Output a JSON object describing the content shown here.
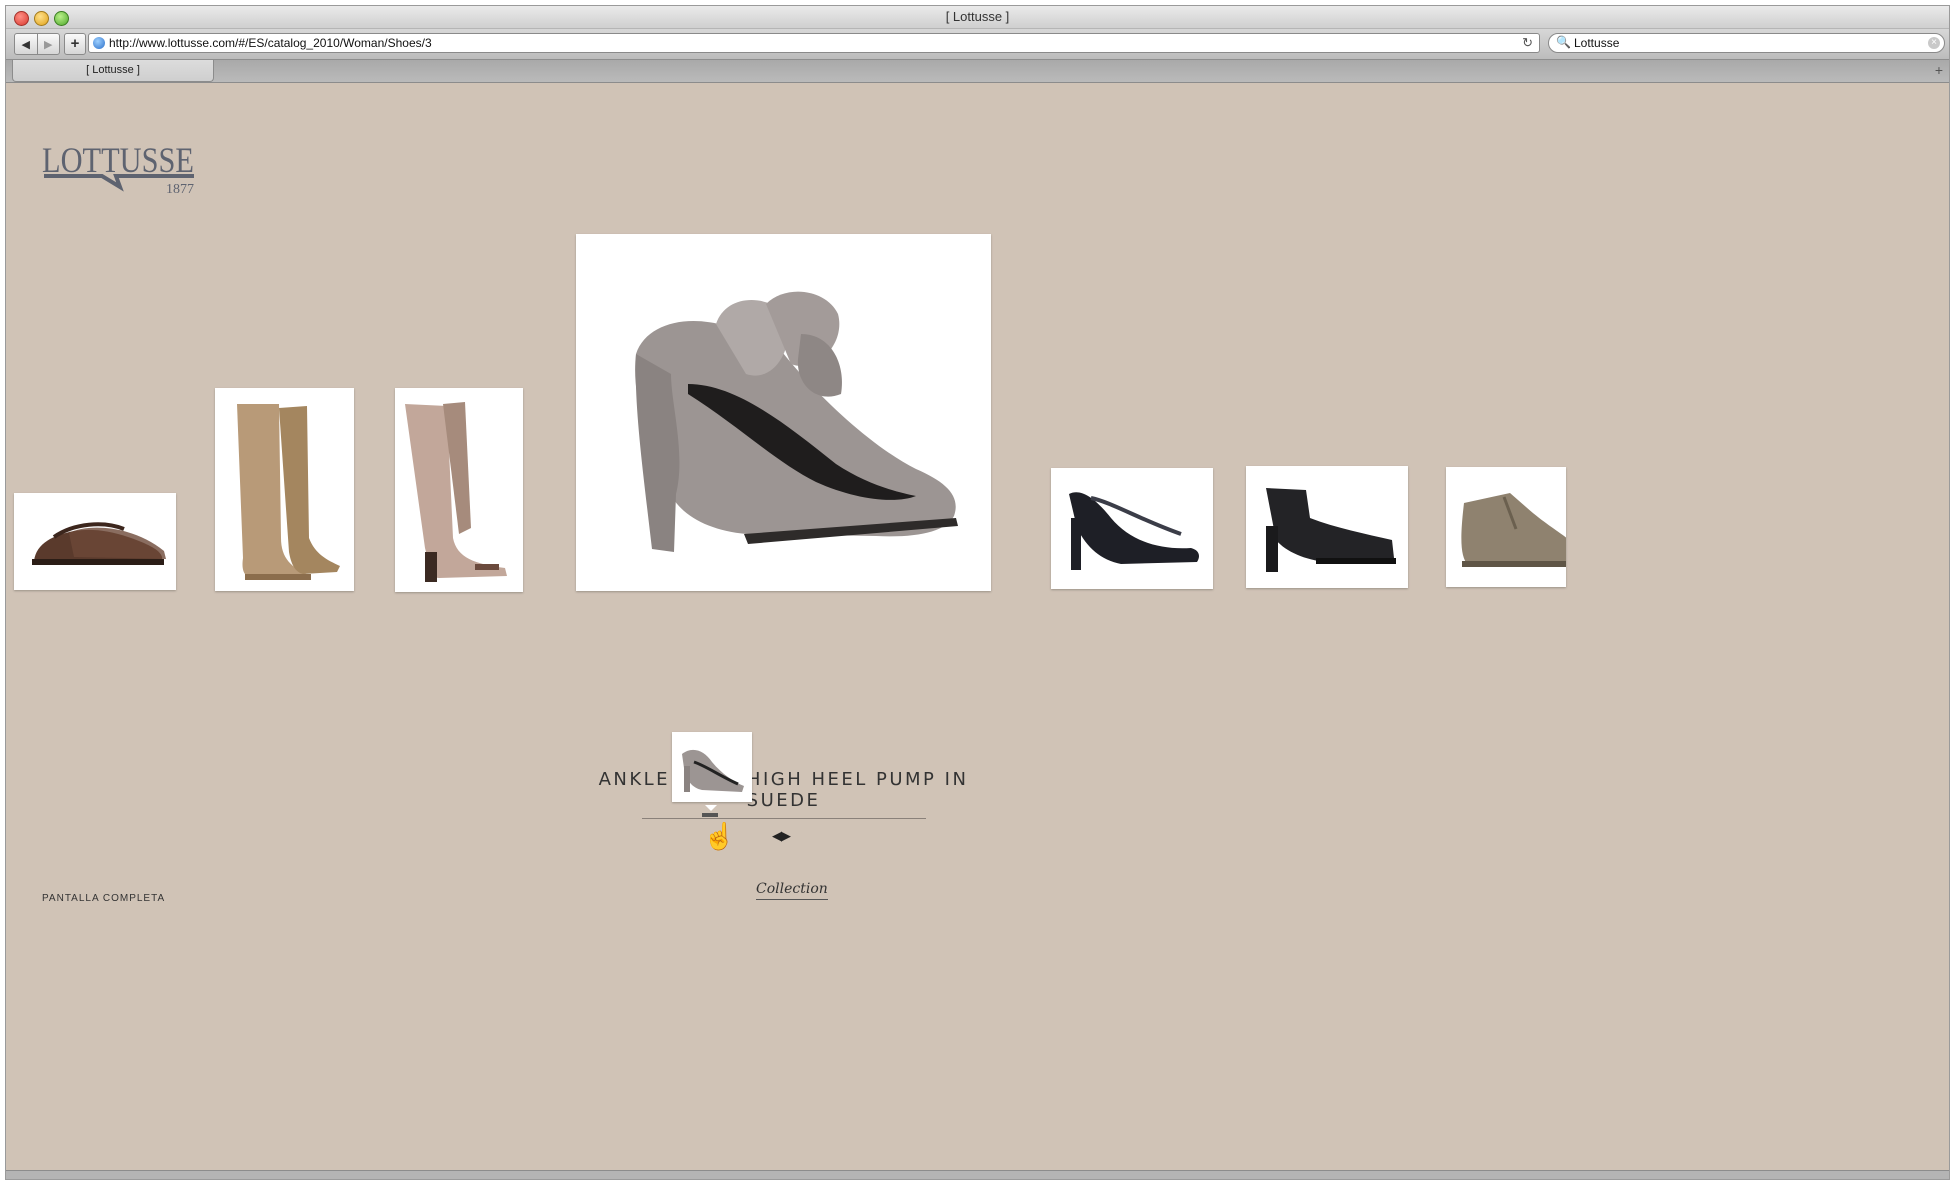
{
  "browser": {
    "window_title": "[ Lottusse ]",
    "url": "http://www.lottusse.com/#/ES/catalog_2010/Woman/Shoes/3",
    "search_value": "Lottusse",
    "tab_label": "[ Lottusse ]"
  },
  "icons": {
    "back": "◀",
    "forward": "▶",
    "add": "+",
    "reload": "↻",
    "search": "🔍",
    "clear": "×",
    "new_tab": "+",
    "cursor": "☝",
    "nav_arrows": "◀▶"
  },
  "brand": {
    "name": "LOTTUSSE",
    "year": "1877"
  },
  "product": {
    "title": "ANKLE KNOT HIGH HEEL PUMP IN SUEDE"
  },
  "footer": {
    "fullscreen": "PANTALLA COMPLETA",
    "collection": "Collection"
  },
  "colors": {
    "page_background": "#d0c3b6"
  }
}
